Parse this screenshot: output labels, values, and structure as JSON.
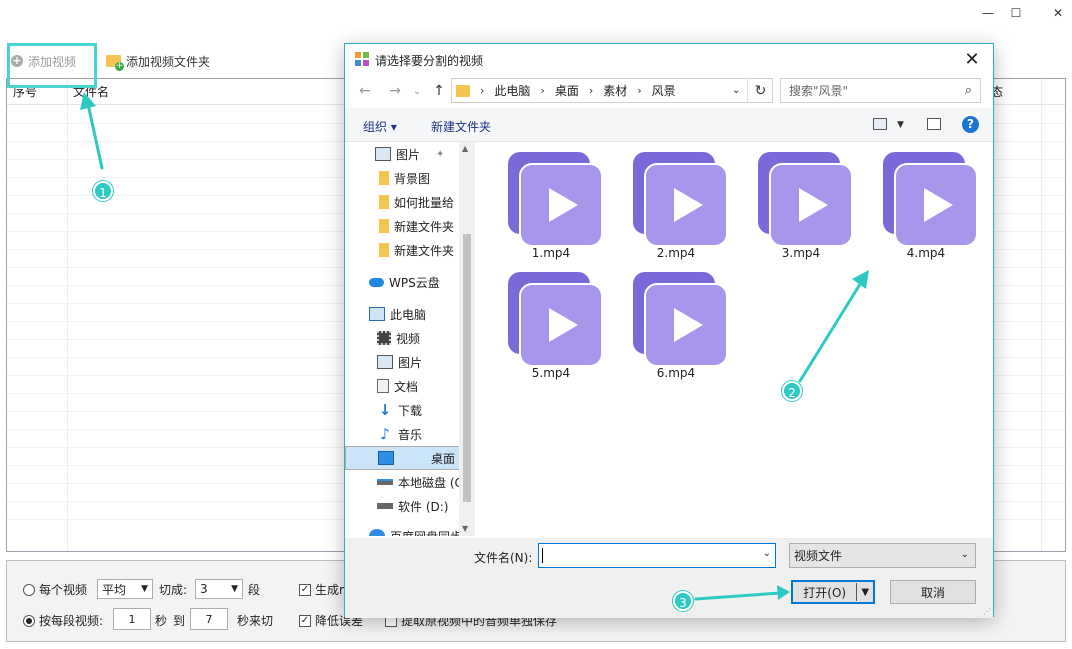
{
  "app": {
    "window_controls": [
      "—",
      "☐",
      "✕"
    ],
    "toolbar": {
      "add_video": "添加视频",
      "add_video_folder": "添加视频文件夹"
    },
    "columns": [
      "序号",
      "文件名",
      "态"
    ],
    "options": {
      "per_video": "每个视频",
      "avg_select": "平均",
      "cut_into": "切成:",
      "segments_value": "3",
      "segments_unit": "段",
      "generate": "生成m",
      "per_segment": "按每段视频:",
      "from_value": "1",
      "sec": "秒",
      "to": "到",
      "to_value": "7",
      "sec_cut": "秒来切",
      "reduce_error": "降低误差",
      "extract_audio": "提取原视频中的音频单独保存"
    }
  },
  "annotations": {
    "badge1": "1",
    "badge2": "2",
    "badge3": "3",
    "color": "#2ec9c2"
  },
  "dialog": {
    "title": "请选择要分割的视频",
    "breadcrumb": [
      "此电脑",
      "桌面",
      "素材",
      "风景"
    ],
    "search_placeholder": "搜索\"风景\"",
    "organize": "组织 ▾",
    "new_folder": "新建文件夹",
    "nav": [
      {
        "label": "图片",
        "icon": "pictures-icon"
      },
      {
        "label": "背景图",
        "icon": "folder-icon"
      },
      {
        "label": "如何批量给",
        "icon": "folder-icon"
      },
      {
        "label": "新建文件夹",
        "icon": "folder-icon"
      },
      {
        "label": "新建文件夹",
        "icon": "folder-icon"
      },
      {
        "label": "WPS云盘",
        "icon": "cloud-icon"
      },
      {
        "label": "此电脑",
        "icon": "computer-icon"
      },
      {
        "label": "视频",
        "icon": "video-icon"
      },
      {
        "label": "图片",
        "icon": "pictures-icon"
      },
      {
        "label": "文档",
        "icon": "document-icon"
      },
      {
        "label": "下载",
        "icon": "download-icon"
      },
      {
        "label": "音乐",
        "icon": "music-icon"
      },
      {
        "label": "桌面",
        "icon": "desktop-icon"
      },
      {
        "label": "本地磁盘 (C",
        "icon": "drive-icon"
      },
      {
        "label": "软件 (D:)",
        "icon": "drive-icon"
      },
      {
        "label": "百度网盘同步",
        "icon": "baidu-icon"
      }
    ],
    "files": [
      "1.mp4",
      "2.mp4",
      "3.mp4",
      "4.mp4",
      "5.mp4",
      "6.mp4"
    ],
    "filename_label": "文件名(N):",
    "filename_value": "",
    "filetype": "视频文件",
    "open": "打开(O)",
    "cancel": "取消"
  }
}
